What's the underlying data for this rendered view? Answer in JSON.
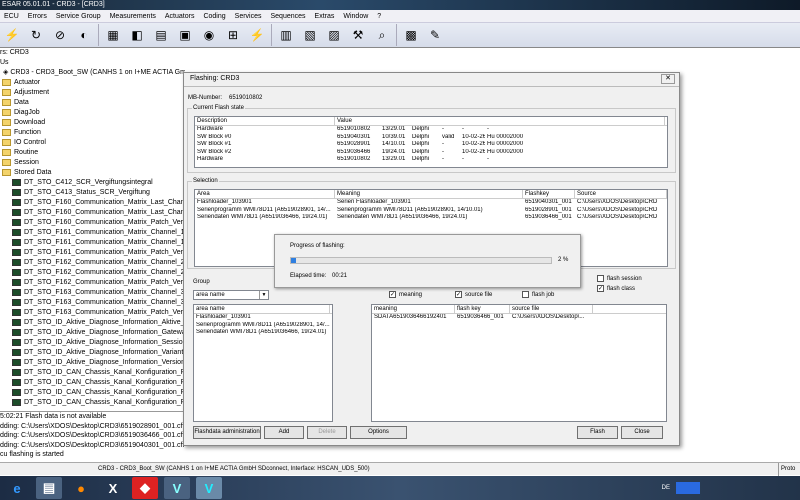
{
  "app": {
    "title": "ESAR 05.01.01 - CRD3 - [CRD3]"
  },
  "menu": [
    "ECU",
    "Errors",
    "Service Group",
    "Measurements",
    "Actuators",
    "Coding",
    "Services",
    "Sequences",
    "Extras",
    "Window",
    "?"
  ],
  "tree": {
    "line1": "rs: CRD3",
    "line2": "Us",
    "root": "CRD3 - CRD3_Boot_SW (CANHS 1 on I+ME ACTIA GmbH SDconnect, Interface: HSCAN_UDS_500)",
    "folders": [
      "Actuator",
      "Adjustment",
      "Data",
      "DiagJob",
      "Download",
      "Function",
      "IO Control",
      "Routine",
      "Session",
      "Stored Data"
    ],
    "items": [
      "DT_STO_C412_SCR_Vergiftungsintegral",
      "DT_STO_C413_Status_SCR_Vergiftung",
      "DT_STO_F160_Communication_Matrix_Last_Channel",
      "DT_STO_F160_Communication_Matrix_Last_Channel",
      "DT_STO_F160_Communication_Matrix_Patch_Version",
      "DT_STO_F161_Communication_Matrix_Channel_1_",
      "DT_STO_F161_Communication_Matrix_Channel_1_",
      "DT_STO_F161_Communication_Matrix_Patch_Version",
      "DT_STO_F162_Communication_Matrix_Channel_2_",
      "DT_STO_F162_Communication_Matrix_Channel_2_",
      "DT_STO_F162_Communication_Matrix_Patch_Version",
      "DT_STO_F163_Communication_Matrix_Channel_3_",
      "DT_STO_F163_Communication_Matrix_Channel_3_",
      "DT_STO_F163_Communication_Matrix_Patch_Version",
      "DT_STO_ID_Aktive_Diagnose_Information_Aktive_S",
      "DT_STO_ID_Aktive_Diagnose_Information_Gateway",
      "DT_STO_ID_Aktive_Diagnose_Information_Session_",
      "DT_STO_ID_Aktive_Diagnose_Information_Variante",
      "DT_STO_ID_Aktive_Diagnose_Information_Version",
      "DT_STO_ID_CAN_Chassis_Kanal_Konfiguration_Phy",
      "DT_STO_ID_CAN_Chassis_Kanal_Konfiguration_Phy",
      "DT_STO_ID_CAN_Chassis_Kanal_Konfiguration_Phy",
      "DT_STO_ID_CAN_Chassis_Kanal_Konfiguration_Phy"
    ]
  },
  "log": [
    "5:02:21 Flash data is not available",
    "dding: C:\\Users\\XDOS\\Desktop\\CRD3\\6519028901_001.cff",
    "dding: C:\\Users\\XDOS\\Desktop\\CRD3\\6519036466_001.cff",
    "dding: C:\\Users\\XDOS\\Desktop\\CRD3\\6519040301_001.cff",
    "cu flashing is started"
  ],
  "status": {
    "text": "CRD3 - CRD3_Boot_SW (CANHS 1 on I+ME ACTIA GmbH SDconnect, Interface: HSCAN_UDS_500)",
    "right": "Proto"
  },
  "dialog": {
    "title": "Flashing: CRD3",
    "mb_label": "MB-Number:",
    "mb_value": "6519010802",
    "flash_state": {
      "label": "Current Flash state",
      "headers": [
        "Description",
        "Value"
      ],
      "rows": [
        [
          "Hardware",
          "6519010802",
          "13/29.01",
          "Delphi",
          "-",
          "-",
          "-"
        ],
        [
          "SW Block #0",
          "6519040301",
          "10/39.01",
          "Delphi",
          "valid",
          "10-02-26",
          "Hu 00002000"
        ],
        [
          "SW Block #1",
          "6519028901",
          "14/10.01",
          "Delphi",
          "-",
          "10-02-26",
          "Hu 00002000"
        ],
        [
          "SW Block #2",
          "6519036466",
          "19/24.01",
          "Delphi",
          "-",
          "10-02-26",
          "Hu 00002000"
        ],
        [
          "Hardware",
          "6519010802",
          "13/29.01",
          "Delphi",
          "-",
          "-",
          "-"
        ]
      ]
    },
    "selection": {
      "label": "Selection",
      "headers": [
        "Area",
        "Meaning",
        "Flashkey",
        "Source"
      ],
      "rows": [
        [
          "Flashloader_103901",
          "Serien Flashloader_103901",
          "6519040301_001",
          "C:\\Users\\XDOS\\Desktop\\CRD"
        ],
        [
          "Serienprogramm WMI78D11 (A6519028901, 14/...",
          "Serienprogramm WMI78D11 (A6519028901, 14/10.01)",
          "6519028901_001",
          "C:\\Users\\XDOS\\Desktop\\CRD"
        ],
        [
          "Seriendaten WMI78D1 (A6519036466, 19/24.01)",
          "Seriendaten WMI78D1 (A6519036466, 19/24.01)",
          "6519036466_001",
          "C:\\Users\\XDOS\\Desktop\\CRD"
        ]
      ]
    },
    "progress": {
      "label": "Progress of flashing:",
      "percent": 2,
      "percent_text": "2 %",
      "elapsed_label": "Elapsed time:",
      "elapsed": "00:21"
    },
    "group_label": "Group",
    "group_value": "area name",
    "checkboxes": [
      {
        "label": "meaning",
        "checked": true
      },
      {
        "label": "source file",
        "checked": true
      },
      {
        "label": "flash job",
        "checked": false
      },
      {
        "label": "flash session",
        "checked": false
      },
      {
        "label": "flash class",
        "checked": true
      }
    ],
    "left_list": {
      "header": "area name",
      "rows": [
        "Flashloader_103901",
        "Serienprogramm WMI78D11 (A6519028901, 14/...",
        "Seriendaten WMI78D1 (A6519036466, 19/24.01)"
      ]
    },
    "right_list": {
      "headers": [
        "meaning",
        "flash key",
        "source file"
      ],
      "rows": [
        [
          "SDATA6519036466192401",
          "6519036466_001",
          "C:\\Users\\XDOS\\Desktop\\..."
        ]
      ]
    },
    "buttons": {
      "admin": "Flashdata administration",
      "add": "Add",
      "delete": "Delete",
      "options": "Options",
      "flash": "Flash",
      "close": "Close"
    }
  },
  "taskbar": {
    "lang": "DE"
  }
}
